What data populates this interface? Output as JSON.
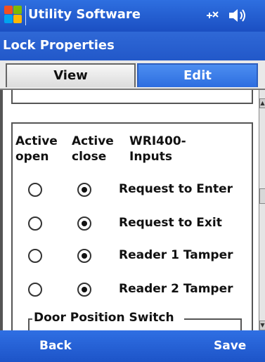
{
  "app": {
    "title": "Utility Software",
    "status_icons": "✧× ◀i"
  },
  "window": {
    "title": "Lock Properties"
  },
  "tabs": [
    {
      "label": "View",
      "active": false
    },
    {
      "label": "Edit",
      "active": true
    }
  ],
  "inputs_section": {
    "headers": {
      "col1_line1": "Active",
      "col1_line2": "open",
      "col2_line1": "Active",
      "col2_line2": "close",
      "col3_line1": "WRI400-",
      "col3_line2": "Inputs"
    },
    "rows": [
      {
        "label": "Request to Enter",
        "active_open": false,
        "active_close": true
      },
      {
        "label": "Request to Exit",
        "active_open": false,
        "active_close": true
      },
      {
        "label": "Reader 1 Tamper",
        "active_open": false,
        "active_close": true
      },
      {
        "label": "Reader 2 Tamper",
        "active_open": false,
        "active_close": true
      }
    ]
  },
  "door_position_group": {
    "title": "Door Position Switch"
  },
  "menu": {
    "left": "Back",
    "right": "Save"
  },
  "colors": {
    "title_bar": "#1f58cc",
    "tab_active": "#3a7ce8"
  }
}
